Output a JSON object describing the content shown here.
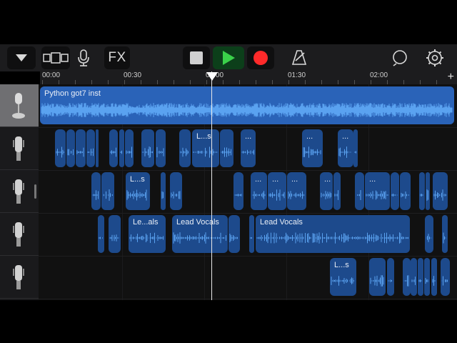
{
  "toolbar": {
    "fx_label": "FX",
    "buttons": [
      "browser-toggle",
      "tracks-view",
      "mic-input",
      "fx",
      "stop",
      "play",
      "record",
      "metronome",
      "loop-browser",
      "settings"
    ],
    "colors": {
      "play": "#3ad14a",
      "record": "#ff2a2a",
      "play_bg": "#0c3f1a"
    }
  },
  "ruler": {
    "labels": [
      "00:00",
      "00:30",
      "01:00",
      "01:30",
      "02:00"
    ],
    "add_track": "+"
  },
  "tracks": [
    {
      "id": "track-1",
      "selected": true
    },
    {
      "id": "track-2",
      "selected": false
    },
    {
      "id": "track-3",
      "selected": false
    },
    {
      "id": "track-4",
      "selected": false
    },
    {
      "id": "track-5",
      "selected": false
    }
  ],
  "region_labels": {
    "python_inst": "Python got7 inst",
    "ls_a": "L...s",
    "dots": "...",
    "ls_b": "L...s",
    "leals": "Le...als",
    "lead_vocals": "Lead Vocals",
    "ls_c": "L...s"
  },
  "colors": {
    "region": "#1d4a8c",
    "region_selected": "#2a63b8",
    "waveform": "#5aa2f0"
  }
}
